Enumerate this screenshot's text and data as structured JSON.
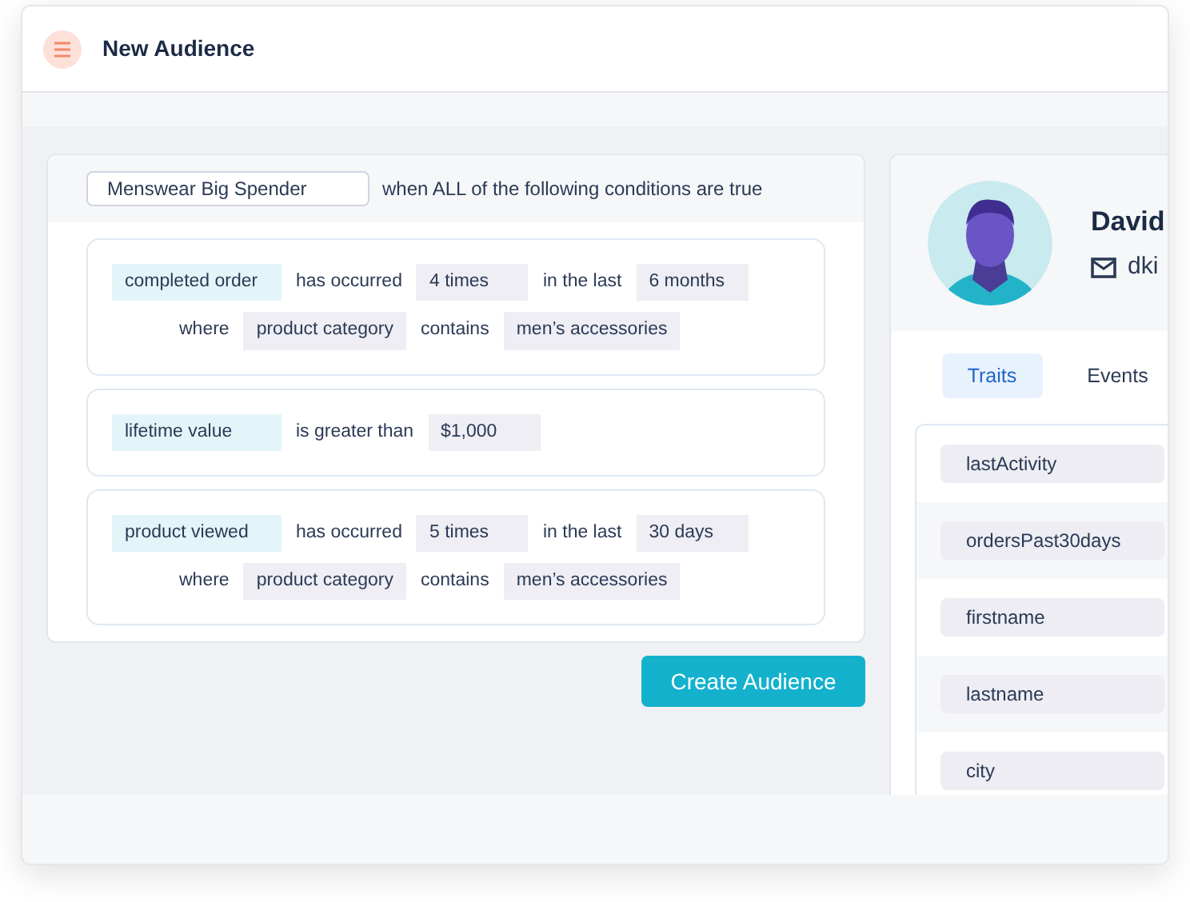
{
  "header": {
    "title": "New Audience"
  },
  "audience": {
    "name": "Menswear Big Spender",
    "rule": "when ALL of the following conditions are true"
  },
  "conditions": [
    {
      "lines": [
        [
          {
            "kind": "event",
            "text": "completed order"
          },
          {
            "kind": "op",
            "text": "has occurred"
          },
          {
            "kind": "value",
            "text": "4 times"
          },
          {
            "kind": "op",
            "text": "in the last"
          },
          {
            "kind": "value",
            "text": "6 months"
          }
        ],
        [
          {
            "kind": "op",
            "text": "where"
          },
          {
            "kind": "value",
            "text": "product category"
          },
          {
            "kind": "op",
            "text": "contains"
          },
          {
            "kind": "value",
            "text": "men’s accessories"
          }
        ]
      ]
    },
    {
      "lines": [
        [
          {
            "kind": "event",
            "text": "lifetime value"
          },
          {
            "kind": "op",
            "text": "is greater than"
          },
          {
            "kind": "value",
            "text": "$1,000"
          }
        ]
      ]
    },
    {
      "lines": [
        [
          {
            "kind": "event",
            "text": "product viewed"
          },
          {
            "kind": "op",
            "text": "has occurred"
          },
          {
            "kind": "value",
            "text": "5 times"
          },
          {
            "kind": "op",
            "text": "in the last"
          },
          {
            "kind": "value",
            "text": "30 days"
          }
        ],
        [
          {
            "kind": "op",
            "text": "where"
          },
          {
            "kind": "value",
            "text": "product category"
          },
          {
            "kind": "op",
            "text": "contains"
          },
          {
            "kind": "value",
            "text": "men’s accessories"
          }
        ]
      ]
    }
  ],
  "create_button": "Create Audience",
  "profile": {
    "name": "David",
    "email": "dki"
  },
  "tabs": [
    {
      "label": "Traits",
      "selected": true
    },
    {
      "label": "Events",
      "selected": false
    }
  ],
  "traits": [
    "lastActivity",
    "ordersPast30days",
    "firstname",
    "lastname",
    "city"
  ]
}
